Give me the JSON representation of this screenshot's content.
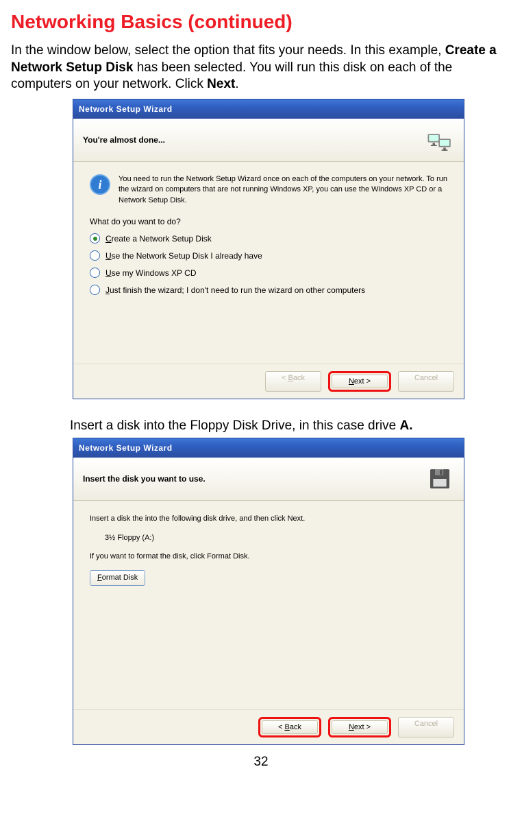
{
  "page": {
    "title": "Networking Basics (continued)",
    "intro_pre": "In the window below, select the option that fits your needs. In this example, ",
    "intro_bold": "Create a Network Setup Disk",
    "intro_post": " has been selected. You will run this disk on each of the computers on your network. Click ",
    "intro_bold2": "Next",
    "intro_tail": ".",
    "caption2_pre": "Insert a disk into the Floppy Disk Drive, in this case drive ",
    "caption2_bold": "A.",
    "number": "32"
  },
  "wizard1": {
    "titlebar": "Network Setup Wizard",
    "header": "You're almost done...",
    "info": "You need to run the Network Setup Wizard once on each of the computers on your network. To run the wizard on computers that are not running Windows XP, you can use the Windows XP CD or a Network Setup Disk.",
    "prompt": "What do you want to do?",
    "options": [
      {
        "u": "C",
        "rest": "reate a Network Setup Disk",
        "checked": true
      },
      {
        "u": "U",
        "rest": "se the Network Setup Disk I already have",
        "checked": false
      },
      {
        "u": "U",
        "rest": "se my Windows XP CD",
        "checked": false
      },
      {
        "u": "J",
        "rest": "ust finish the wizard; I don't need to run the wizard on other computers",
        "checked": false
      }
    ],
    "buttons": {
      "back_u": "B",
      "back": "ack",
      "next_u": "N",
      "next": "ext >",
      "cancel": "Cancel",
      "back_prefix": "< "
    }
  },
  "wizard2": {
    "titlebar": "Network Setup Wizard",
    "header": "Insert the disk you want to use.",
    "line1": "Insert a disk the into the following disk drive, and then click Next.",
    "drive": "3½ Floppy (A:)",
    "line2": "If you want to format the disk, click Format Disk.",
    "format_u": "F",
    "format": "ormat Disk",
    "buttons": {
      "back_u": "B",
      "back": "ack",
      "next_u": "N",
      "next": "ext >",
      "cancel": "Cancel",
      "back_prefix": "< "
    }
  }
}
